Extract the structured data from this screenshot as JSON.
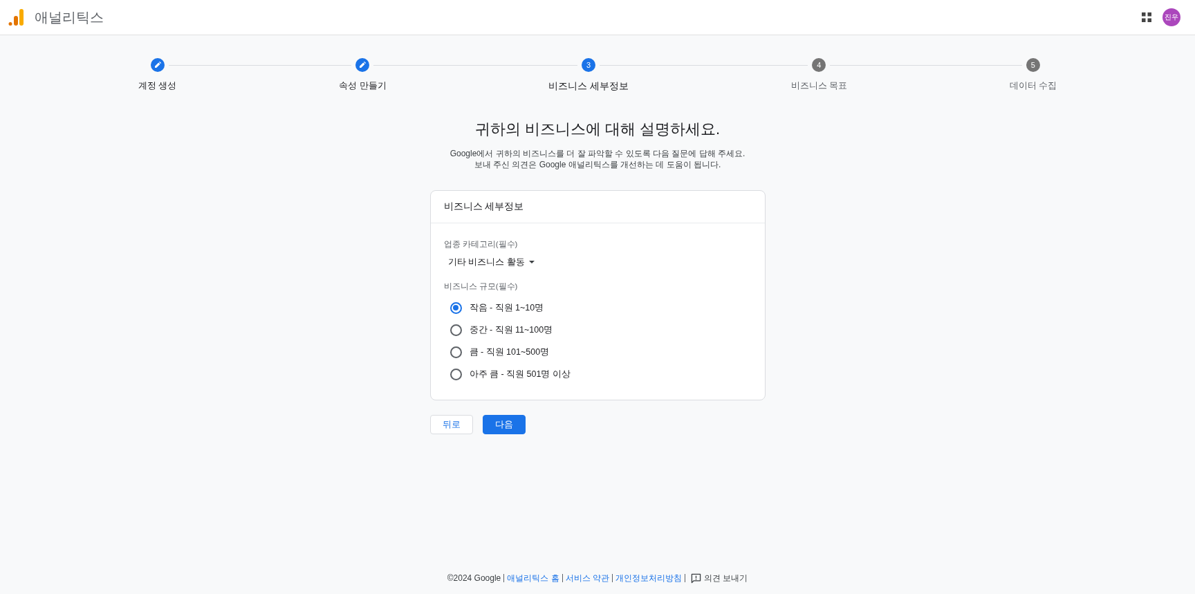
{
  "header": {
    "product_name": "애널리틱스",
    "avatar_initials": "진우"
  },
  "stepper": {
    "steps": [
      {
        "label": "계정 생성",
        "kind": "done"
      },
      {
        "label": "속성 만들기",
        "kind": "done"
      },
      {
        "label": "비즈니스 세부정보",
        "number": "3",
        "kind": "current"
      },
      {
        "label": "비즈니스 목표",
        "number": "4",
        "kind": "todo"
      },
      {
        "label": "데이터 수집",
        "number": "5",
        "kind": "todo"
      }
    ]
  },
  "page": {
    "title": "귀하의 비즈니스에 대해 설명하세요.",
    "description": [
      "Google에서 귀하의 비즈니스를 더 잘 파악할 수 있도록 다음 질문에 답해 주세요.",
      "보내 주신 의견은 Google 애널리틱스를 개선하는 데 도움이 됩니다."
    ]
  },
  "card": {
    "title": "비즈니스 세부정보",
    "industry_field": {
      "label": "업종 카테고리(필수)",
      "value": "기타 비즈니스 활동"
    },
    "size_field": {
      "label": "비즈니스 규모(필수)",
      "options": [
        {
          "label": "작음 - 직원 1~10명",
          "selected": true
        },
        {
          "label": "중간 - 직원 11~100명",
          "selected": false
        },
        {
          "label": "큼 - 직원 101~500명",
          "selected": false
        },
        {
          "label": "아주 큼 - 직원 501명 이상",
          "selected": false
        }
      ]
    }
  },
  "buttons": [
    {
      "label": "뒤로",
      "kind": "secondary"
    },
    {
      "label": "다음",
      "kind": "primary"
    }
  ],
  "footer": {
    "items": [
      {
        "kind": "text",
        "label": "©2024 Google"
      },
      {
        "kind": "link",
        "label": "애널리틱스 홈"
      },
      {
        "kind": "link",
        "label": "서비스 약관"
      },
      {
        "kind": "link",
        "label": "개인정보처리방침"
      },
      {
        "kind": "feedback",
        "label": "의견 보내기"
      }
    ]
  }
}
